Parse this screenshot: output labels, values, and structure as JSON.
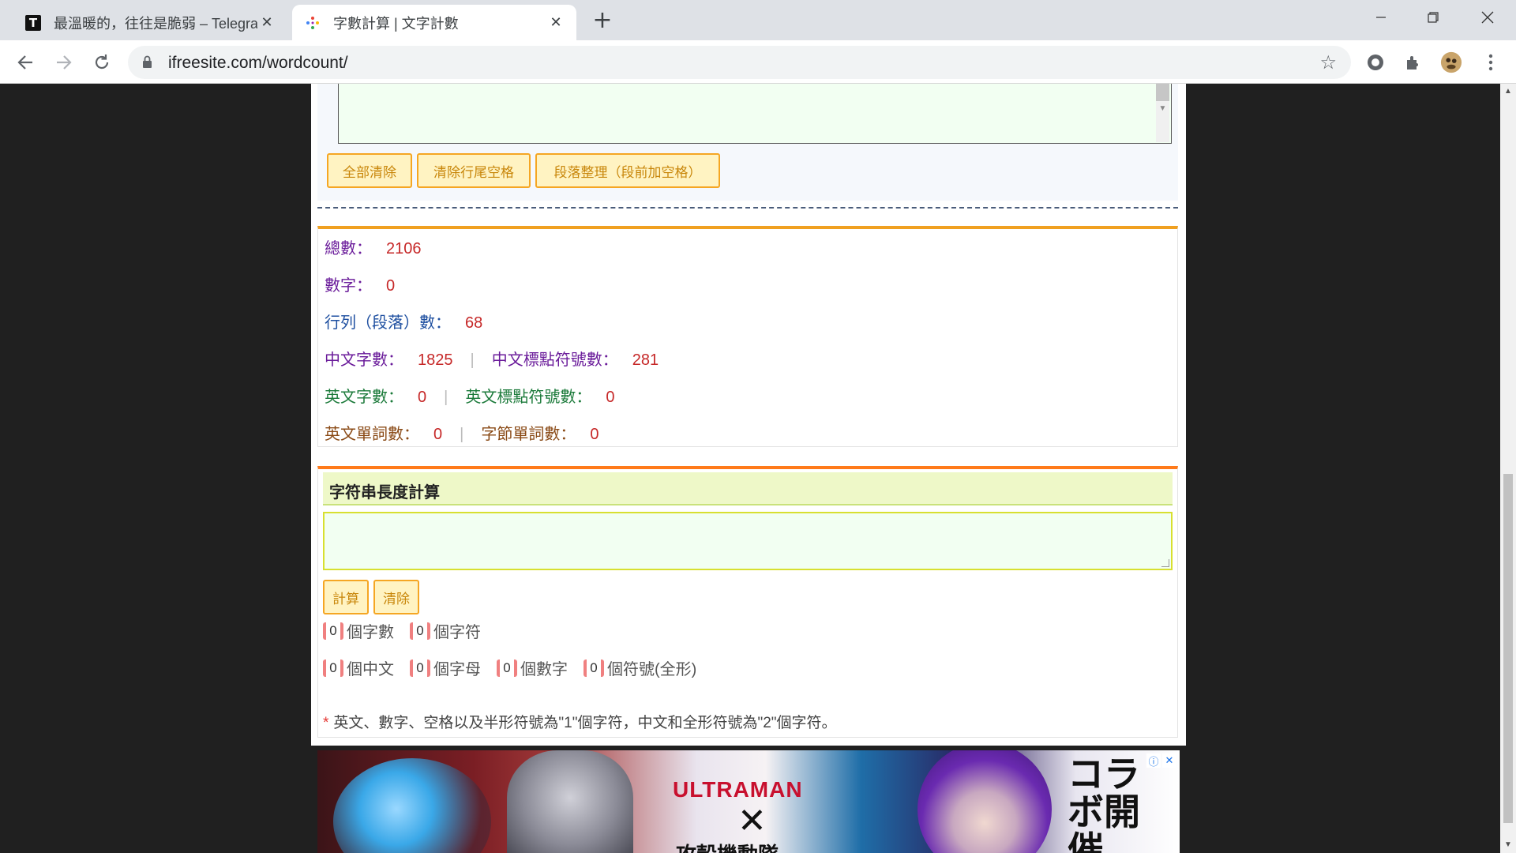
{
  "browser": {
    "tabs": [
      {
        "title": "最溫暖的，往往是脆弱 – Telegra",
        "favicon": "T",
        "active": false
      },
      {
        "title": "字數計算 | 文字計數",
        "favicon": "pinwheel",
        "active": true
      }
    ],
    "url": "ifreesite.com/wordcount/",
    "window_controls": [
      "minimize",
      "restore",
      "close"
    ]
  },
  "editor": {
    "buttons": [
      "全部清除",
      "清除行尾空格",
      "段落整理（段前加空格）"
    ]
  },
  "stats": {
    "total": {
      "label": "總數：",
      "value": "2106"
    },
    "digits": {
      "label": "數字：",
      "value": "0"
    },
    "lines": {
      "label": "行列（段落）數：",
      "value": "68"
    },
    "chinese_chars": {
      "label": "中文字數：",
      "value": "1825"
    },
    "chinese_punct": {
      "label": "中文標點符號數：",
      "value": "281"
    },
    "english_chars": {
      "label": "英文字數：",
      "value": "0"
    },
    "english_punct": {
      "label": "英文標點符號數：",
      "value": "0"
    },
    "english_words": {
      "label": "英文單詞數：",
      "value": "0"
    },
    "syllable_words": {
      "label": "字節單詞數：",
      "value": "0"
    },
    "separator": "|"
  },
  "string_length": {
    "title": "字符串長度計算",
    "textarea_value": "",
    "calc_button": "計算",
    "clear_button": "清除",
    "results_row1": [
      {
        "value": "0",
        "label": "個字數"
      },
      {
        "value": "0",
        "label": "個字符"
      }
    ],
    "results_row2": [
      {
        "value": "0",
        "label": "個中文"
      },
      {
        "value": "0",
        "label": "個字母"
      },
      {
        "value": "0",
        "label": "個數字"
      },
      {
        "value": "0",
        "label": "個符號(全形)"
      }
    ],
    "note_mark": "*",
    "note": "英文、數字、空格以及半形符號為\"1\"個字符，中文和全形符號為\"2\"個字符。"
  },
  "ad": {
    "brand": "ULTRAMAN",
    "cross": "✕",
    "subtitle": "攻殻機動隊",
    "vertical_text": "コラボ開催"
  },
  "colors": {
    "accent_orange": "#f0a020",
    "button_border": "#f5a623",
    "value_red": "#c62828"
  }
}
